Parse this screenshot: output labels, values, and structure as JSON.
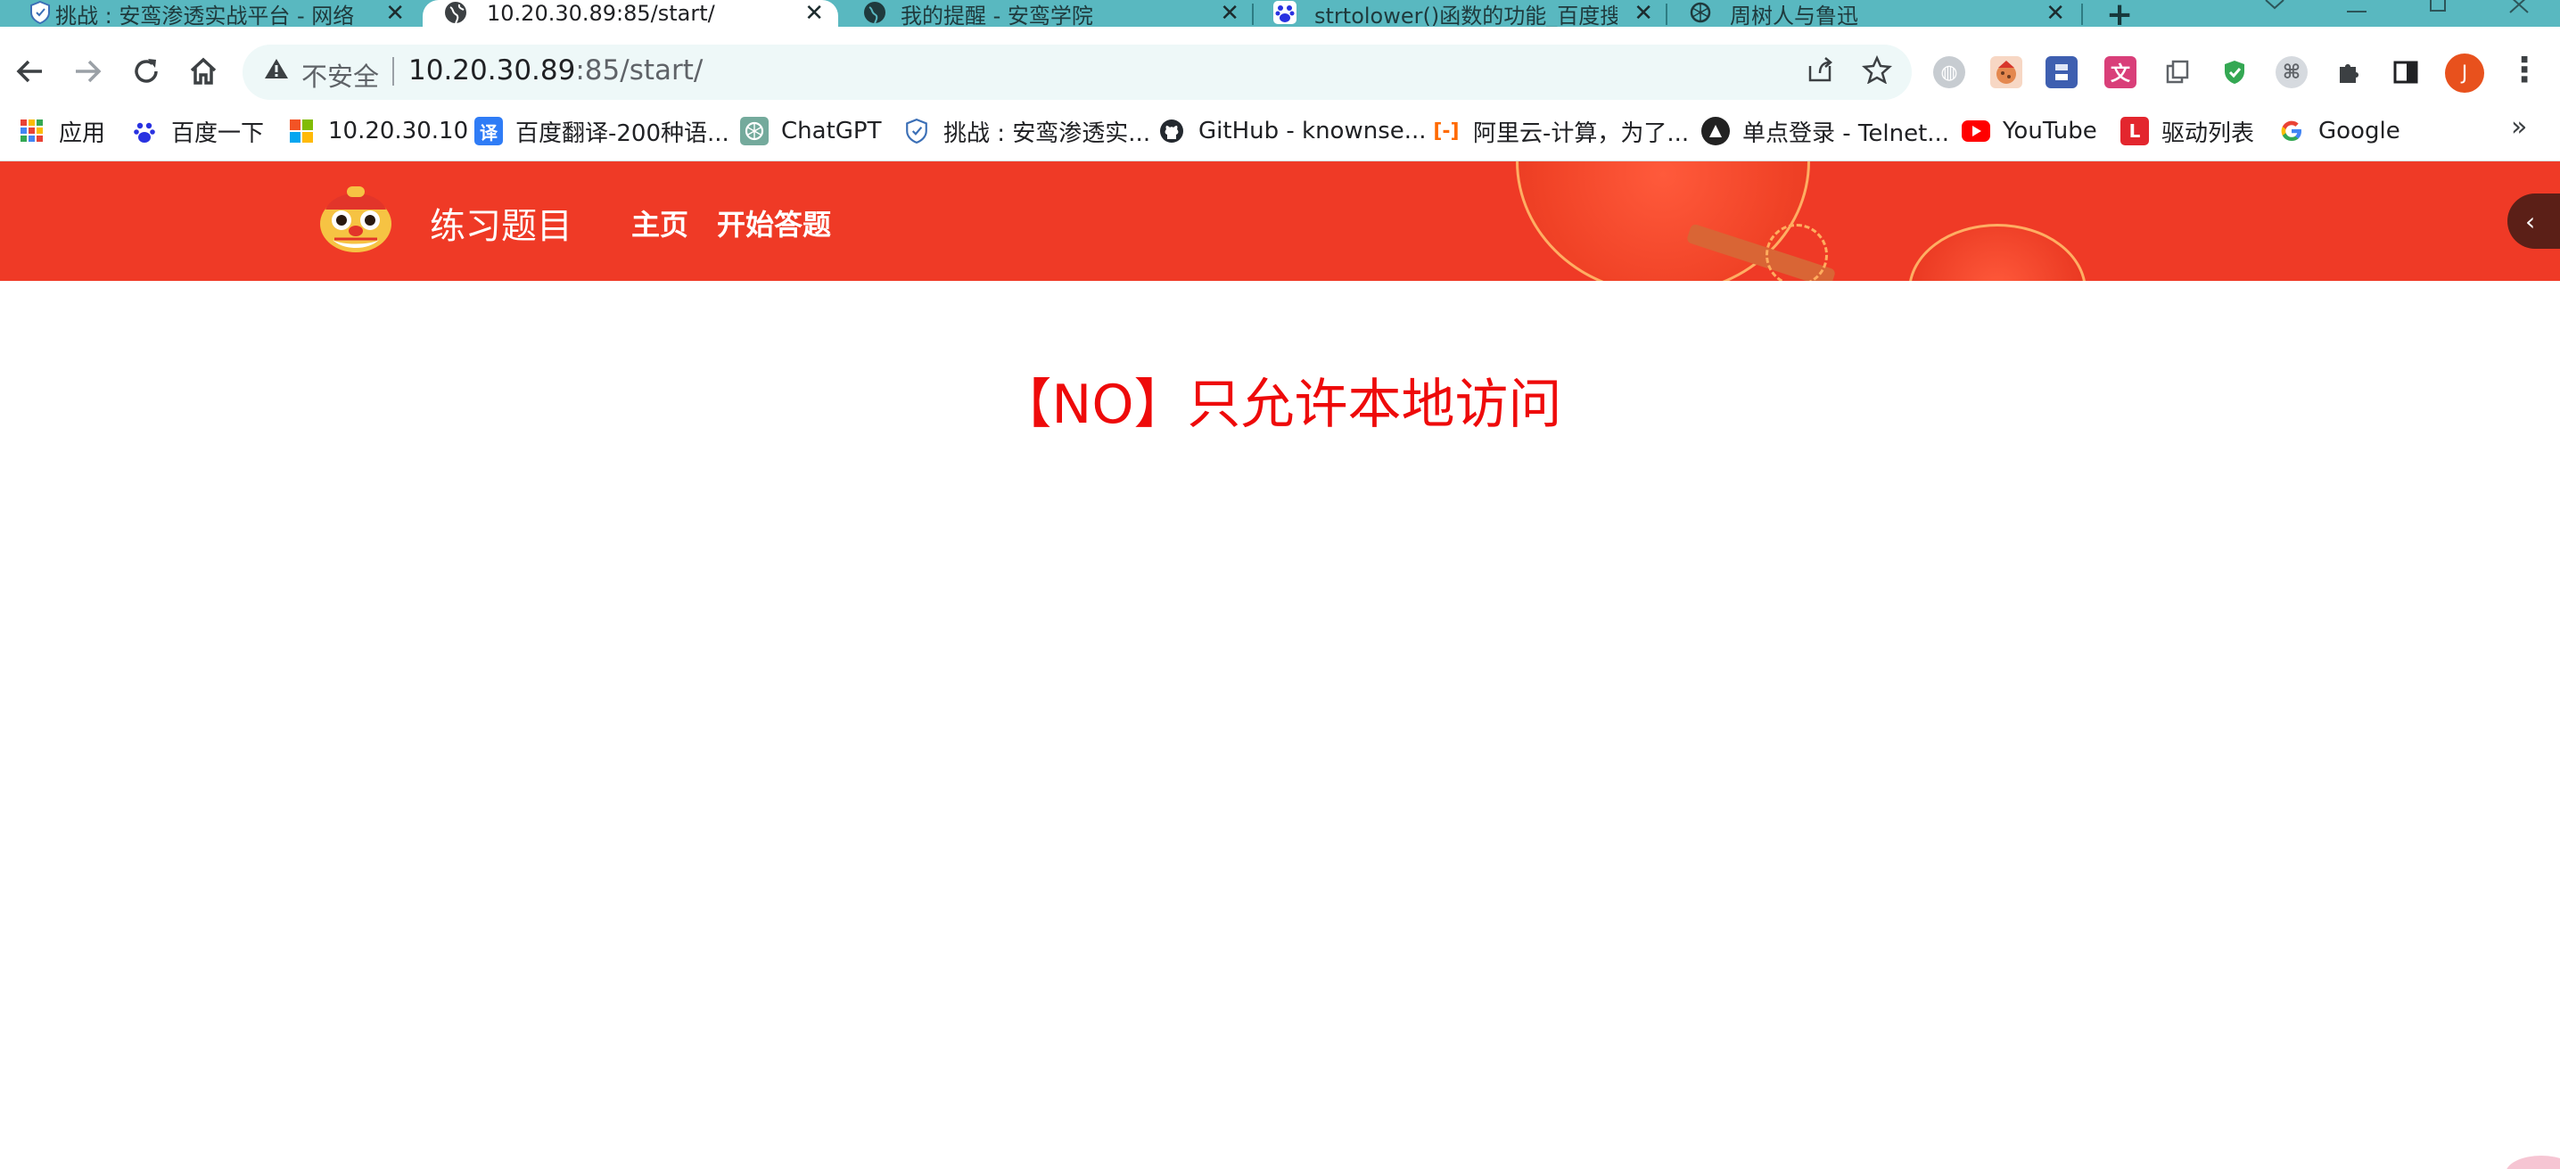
{
  "browser": {
    "tabs": [
      {
        "title": "挑战 : 安鸾渗透实战平台 - 网络",
        "favicon": "shield-icon",
        "active": false
      },
      {
        "title": "10.20.30.89:85/start/",
        "favicon": "globe-icon",
        "active": true
      },
      {
        "title": "我的提醒 - 安鸾学院",
        "favicon": "globe-icon",
        "active": false
      },
      {
        "title": "strtolower()函数的功能_百度搜",
        "favicon": "baidu-paw-icon",
        "active": false
      },
      {
        "title": "周树人与鲁迅",
        "favicon": "chatgpt-icon",
        "active": false
      }
    ],
    "new_tab_label": "+",
    "close_glyph": "✕",
    "omnibox": {
      "security_label": "不安全",
      "url_host": "10.20.30.89",
      "url_rest": ":85/start/"
    },
    "profile_initial": "J",
    "bookmarks": [
      {
        "label": "应用",
        "icon": "apps-grid-icon",
        "color": "#e94235"
      },
      {
        "label": "百度一下",
        "icon": "baidu-paw-icon",
        "color": "#2932e1"
      },
      {
        "label": "10.20.30.10",
        "icon": "windows-logo-icon",
        "color": "#f35325"
      },
      {
        "label": "百度翻译-200种语...",
        "icon": "translate-icon",
        "color": "#2f7cf6"
      },
      {
        "label": "ChatGPT",
        "icon": "chatgpt-icon",
        "color": "#74aa9c"
      },
      {
        "label": "挑战 : 安鸾渗透实...",
        "icon": "shield-icon",
        "color": "#3b6fb6"
      },
      {
        "label": "GitHub - knownse...",
        "icon": "github-icon",
        "color": "#24292f"
      },
      {
        "label": "阿里云-计算，为了...",
        "icon": "aliyun-icon",
        "color": "#ff6a00"
      },
      {
        "label": "单点登录 - Telnet...",
        "icon": "telnet-icon",
        "color": "#222222"
      },
      {
        "label": "YouTube",
        "icon": "youtube-icon",
        "color": "#ff0000"
      },
      {
        "label": "驱动列表",
        "icon": "driver-list-icon",
        "color": "#e3262e"
      },
      {
        "label": "Google",
        "icon": "google-icon",
        "color": "#4285f4"
      }
    ],
    "more_bookmarks_glyph": "»"
  },
  "site": {
    "title": "练习题目",
    "nav": [
      {
        "label": "主页"
      },
      {
        "label": "开始答题"
      }
    ],
    "side_toggle_glyph": "‹"
  },
  "content": {
    "message": "【NO】只允许本地访问"
  },
  "colors": {
    "tabstrip": "#59b8c0",
    "header": "#ef3a26",
    "message": "#ee0a0a"
  }
}
